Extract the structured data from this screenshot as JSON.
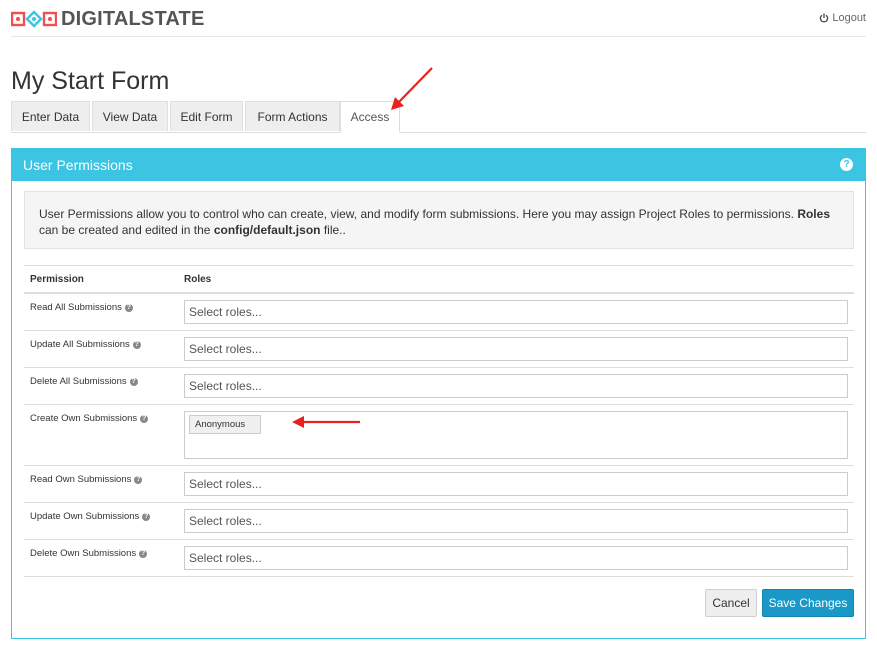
{
  "header": {
    "brand": "DIGITALSTATE",
    "logout_label": "Logout",
    "icons": {
      "logo": "logo-icon",
      "power": "power-icon"
    }
  },
  "page": {
    "title": "My Start Form"
  },
  "tabs": [
    {
      "label": "Enter Data"
    },
    {
      "label": "View Data"
    },
    {
      "label": "Edit Form"
    },
    {
      "label": "Form Actions"
    },
    {
      "label": "Access",
      "active": true
    }
  ],
  "panel": {
    "title": "User Permissions",
    "help_icon": "?",
    "info": {
      "text_1": "User Permissions allow you to control who can create, view, and modify form submissions. Here you may assign Project Roles to permissions.",
      "bold_1": "Roles",
      "text_2": "can be created and edited in the",
      "bold_2": "config/default.json",
      "text_3": "file.."
    },
    "columns": {
      "permission": "Permission",
      "roles": "Roles"
    },
    "permissions": [
      {
        "label": "Read All Submissions",
        "placeholder": "Select roles..."
      },
      {
        "label": "Update All Submissions",
        "placeholder": "Select roles..."
      },
      {
        "label": "Delete All Submissions",
        "placeholder": "Select roles..."
      },
      {
        "label": "Create Own Submissions",
        "selected": [
          "Anonymous"
        ]
      },
      {
        "label": "Read Own Submissions",
        "placeholder": "Select roles..."
      },
      {
        "label": "Update Own Submissions",
        "placeholder": "Select roles..."
      },
      {
        "label": "Delete Own Submissions",
        "placeholder": "Select roles..."
      }
    ],
    "buttons": {
      "cancel": "Cancel",
      "save": "Save Changes"
    }
  },
  "colors": {
    "accent": "#3cc4e3",
    "primary_button": "#1a99c9",
    "annotation_arrow": "#e8211f"
  }
}
